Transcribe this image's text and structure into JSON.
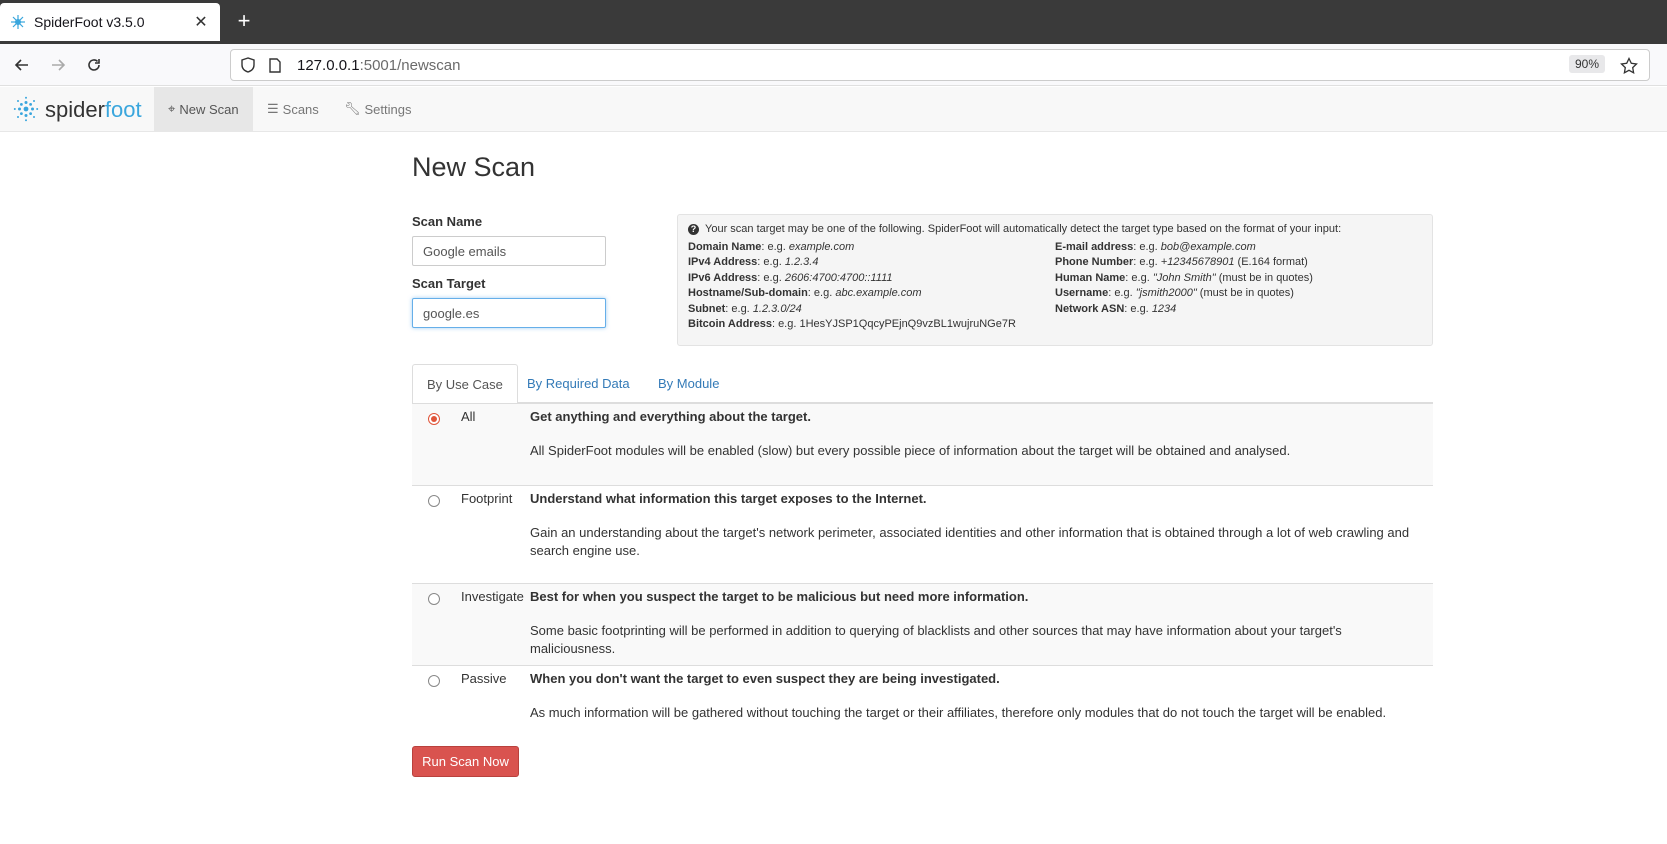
{
  "browser": {
    "tab_title": "SpiderFoot v3.5.0",
    "url_host": "127.0.0.1",
    "url_path": ":5001/newscan",
    "zoom": "90%"
  },
  "app": {
    "logo_prefix": "spider",
    "logo_suffix": "foot",
    "nav": {
      "new_scan": "New Scan",
      "scans": "Scans",
      "settings": "Settings"
    }
  },
  "page": {
    "title": "New Scan",
    "scan_name_label": "Scan Name",
    "scan_name_value": "Google emails",
    "scan_target_label": "Scan Target",
    "scan_target_value": "google.es"
  },
  "info": {
    "intro": "Your scan target may be one of the following. SpiderFoot will automatically detect the target type based on the format of your input:",
    "left": [
      {
        "label": "Domain Name",
        "prefix": ": e.g. ",
        "example": "example.com",
        "suffix": ""
      },
      {
        "label": "IPv4 Address",
        "prefix": ": e.g. ",
        "example": "1.2.3.4",
        "suffix": ""
      },
      {
        "label": "IPv6 Address",
        "prefix": ": e.g. ",
        "example": "2606:4700:4700::1111",
        "suffix": ""
      },
      {
        "label": "Hostname/Sub-domain",
        "prefix": ": e.g. ",
        "example": "abc.example.com",
        "suffix": ""
      },
      {
        "label": "Subnet",
        "prefix": ": e.g. ",
        "example": "1.2.3.0/24",
        "suffix": ""
      },
      {
        "label": "Bitcoin Address",
        "prefix": ": e.g. 1HesYJSP1QqcyPEjnQ9vzBL1wujruNGe7R",
        "example": "",
        "suffix": ""
      }
    ],
    "right": [
      {
        "label": "E-mail address",
        "prefix": ": e.g. ",
        "example": "bob@example.com",
        "suffix": ""
      },
      {
        "label": "Phone Number",
        "prefix": ": e.g. ",
        "example": "+12345678901",
        "suffix": " (E.164 format)"
      },
      {
        "label": "Human Name",
        "prefix": ": e.g. ",
        "example": "\"John Smith\"",
        "suffix": " (must be in quotes)"
      },
      {
        "label": "Username",
        "prefix": ": e.g. ",
        "example": "\"jsmith2000\"",
        "suffix": " (must be in quotes)"
      },
      {
        "label": "Network ASN",
        "prefix": ": e.g. ",
        "example": "1234",
        "suffix": ""
      }
    ]
  },
  "tabs": [
    "By Use Case",
    "By Required Data",
    "By Module"
  ],
  "use_cases": [
    {
      "name": "All",
      "title": "Get anything and everything about the target.",
      "desc": "All SpiderFoot modules will be enabled (slow) but every possible piece of information about the target will be obtained and analysed.",
      "selected": true
    },
    {
      "name": "Footprint",
      "title": "Understand what information this target exposes to the Internet.",
      "desc": "Gain an understanding about the target's network perimeter, associated identities and other information that is obtained through a lot of web crawling and search engine use.",
      "selected": false
    },
    {
      "name": "Investigate",
      "title": "Best for when you suspect the target to be malicious but need more information.",
      "desc": "Some basic footprinting will be performed in addition to querying of blacklists and other sources that may have information about your target's maliciousness.",
      "selected": false
    },
    {
      "name": "Passive",
      "title": "When you don't want the target to even suspect they are being investigated.",
      "desc": "As much information will be gathered without touching the target or their affiliates, therefore only modules that do not touch the target will be enabled.",
      "selected": false
    }
  ],
  "run_button": "Run Scan Now",
  "colors": {
    "accent": "#3aa6dd",
    "danger": "#d9534f",
    "link": "#337ab7"
  }
}
